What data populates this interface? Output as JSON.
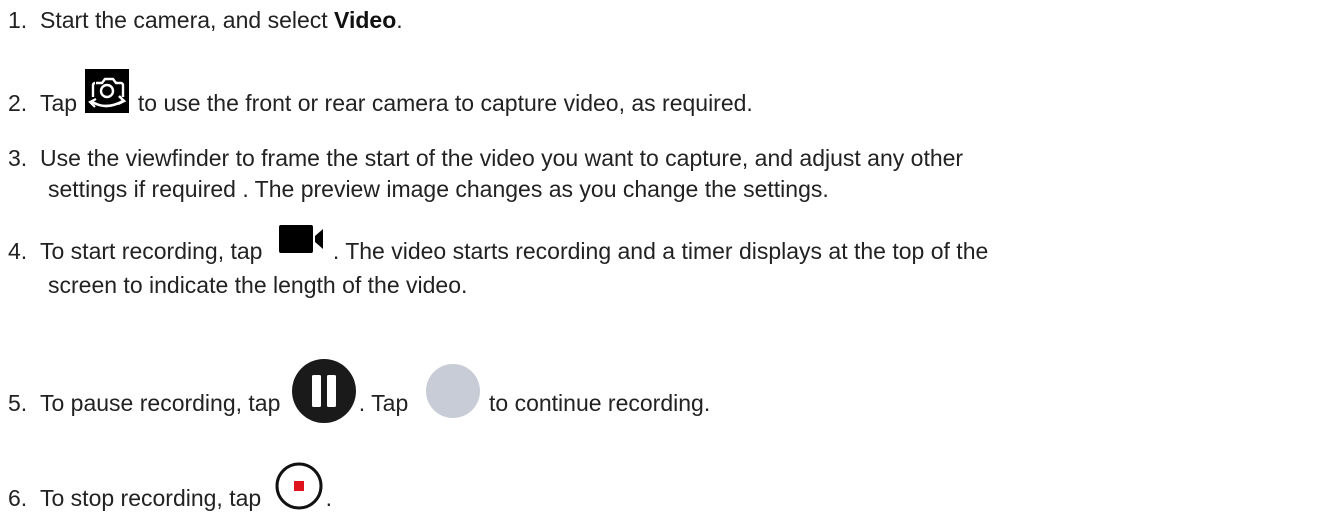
{
  "steps": [
    {
      "num": "1.",
      "pre": "Start the camera, and select ",
      "bold": "Video",
      "post": "."
    },
    {
      "num": "2.",
      "pre": "Tap",
      "post": "to use the front or rear camera to capture video, as required.",
      "icon": "switch-camera-icon"
    },
    {
      "num": "3.",
      "line1": "Use the viewfinder to frame the start of the video you want to capture, and adjust any other",
      "line2": "settings if required . The preview image changes as you change the settings."
    },
    {
      "num": "4.",
      "pre": "To start recording, tap",
      "post": ". The video starts recording and a timer displays at the top of the",
      "line2": "screen to indicate the length of the video.",
      "icon": "video-camera-icon"
    },
    {
      "num": "5.",
      "pre": "To pause recording, tap",
      "mid": ". Tap",
      "post": "to continue recording.",
      "icon": "pause-icon",
      "icon2": "resume-circle-icon"
    },
    {
      "num": "6.",
      "pre": "To stop recording, tap",
      "post": ".",
      "icon": "stop-icon"
    }
  ],
  "colors": {
    "text": "#222222",
    "stop_red": "#e0141e",
    "resume_gray": "#c8ccd6"
  }
}
